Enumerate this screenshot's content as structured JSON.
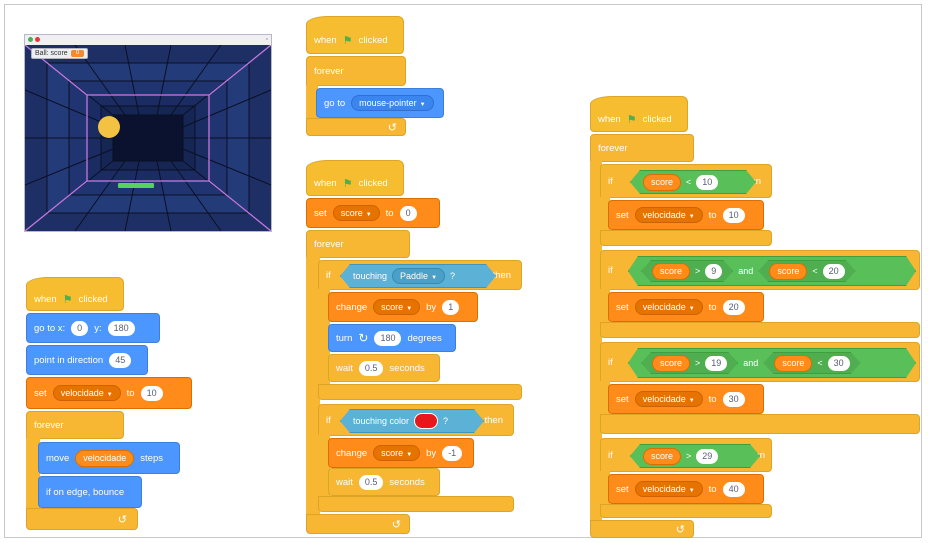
{
  "stage": {
    "monitor_label": "Ball: score",
    "monitor_value": "0"
  },
  "colors": {
    "events": "#f5bd2f",
    "control": "#f7b733",
    "motion": "#4c97ff",
    "variables": "#ff8c1a",
    "sensing": "#5cb1d6",
    "operators": "#59c059",
    "stage_bg": "#1e2f66"
  },
  "icons": {
    "flag": "green-flag-icon",
    "loop_arrow": "loop-arrow-icon",
    "rotate": "turn-clockwise-icon"
  },
  "script1": {
    "hat_when": "when",
    "hat_clicked": "clicked",
    "goto_label": "go to x:",
    "x_value": "0",
    "y_label": "y:",
    "y_value": "180",
    "point_label": "point in direction",
    "point_value": "45",
    "set_label": "set",
    "set_var": "velocidade",
    "to_label": "to",
    "set_value": "10",
    "forever_label": "forever",
    "move_label": "move",
    "move_var": "velocidade",
    "steps_label": "steps",
    "bounce_label": "if on edge, bounce"
  },
  "script2": {
    "hat_when": "when",
    "hat_clicked": "clicked",
    "forever_label": "forever",
    "goto_label": "go to",
    "goto_target": "mouse-pointer"
  },
  "script3": {
    "hat_when": "when",
    "hat_clicked": "clicked",
    "set_label": "set",
    "set_var": "score",
    "to_label": "to",
    "set_value": "0",
    "forever_label": "forever",
    "if1_label": "if",
    "touching_label": "touching",
    "touching_target": "Paddle",
    "q": "?",
    "then_label": "then",
    "change_label": "change",
    "change_var": "score",
    "by_label": "by",
    "change_value": "1",
    "turn_label": "turn",
    "turn_value": "180",
    "degrees_label": "degrees",
    "wait_label": "wait",
    "wait_value": "0.5",
    "seconds_label": "seconds",
    "if2_label": "if",
    "touching_color_label": "touching color",
    "change2_value": "-1",
    "wait2_value": "0.5"
  },
  "script4": {
    "hat_when": "when",
    "hat_clicked": "clicked",
    "forever_label": "forever",
    "if_label": "if",
    "then_label": "then",
    "and_label": "and",
    "set_label": "set",
    "var": "velocidade",
    "to_label": "to",
    "score": "score",
    "c1_op": "<",
    "c1_val": "10",
    "set1": "10",
    "c2a_op": ">",
    "c2a_val": "9",
    "c2b_op": "<",
    "c2b_val": "20",
    "set2": "20",
    "c3a_op": ">",
    "c3a_val": "19",
    "c3b_op": "<",
    "c3b_val": "30",
    "set3": "30",
    "c4_op": ">",
    "c4_val": "29",
    "set4": "40"
  }
}
